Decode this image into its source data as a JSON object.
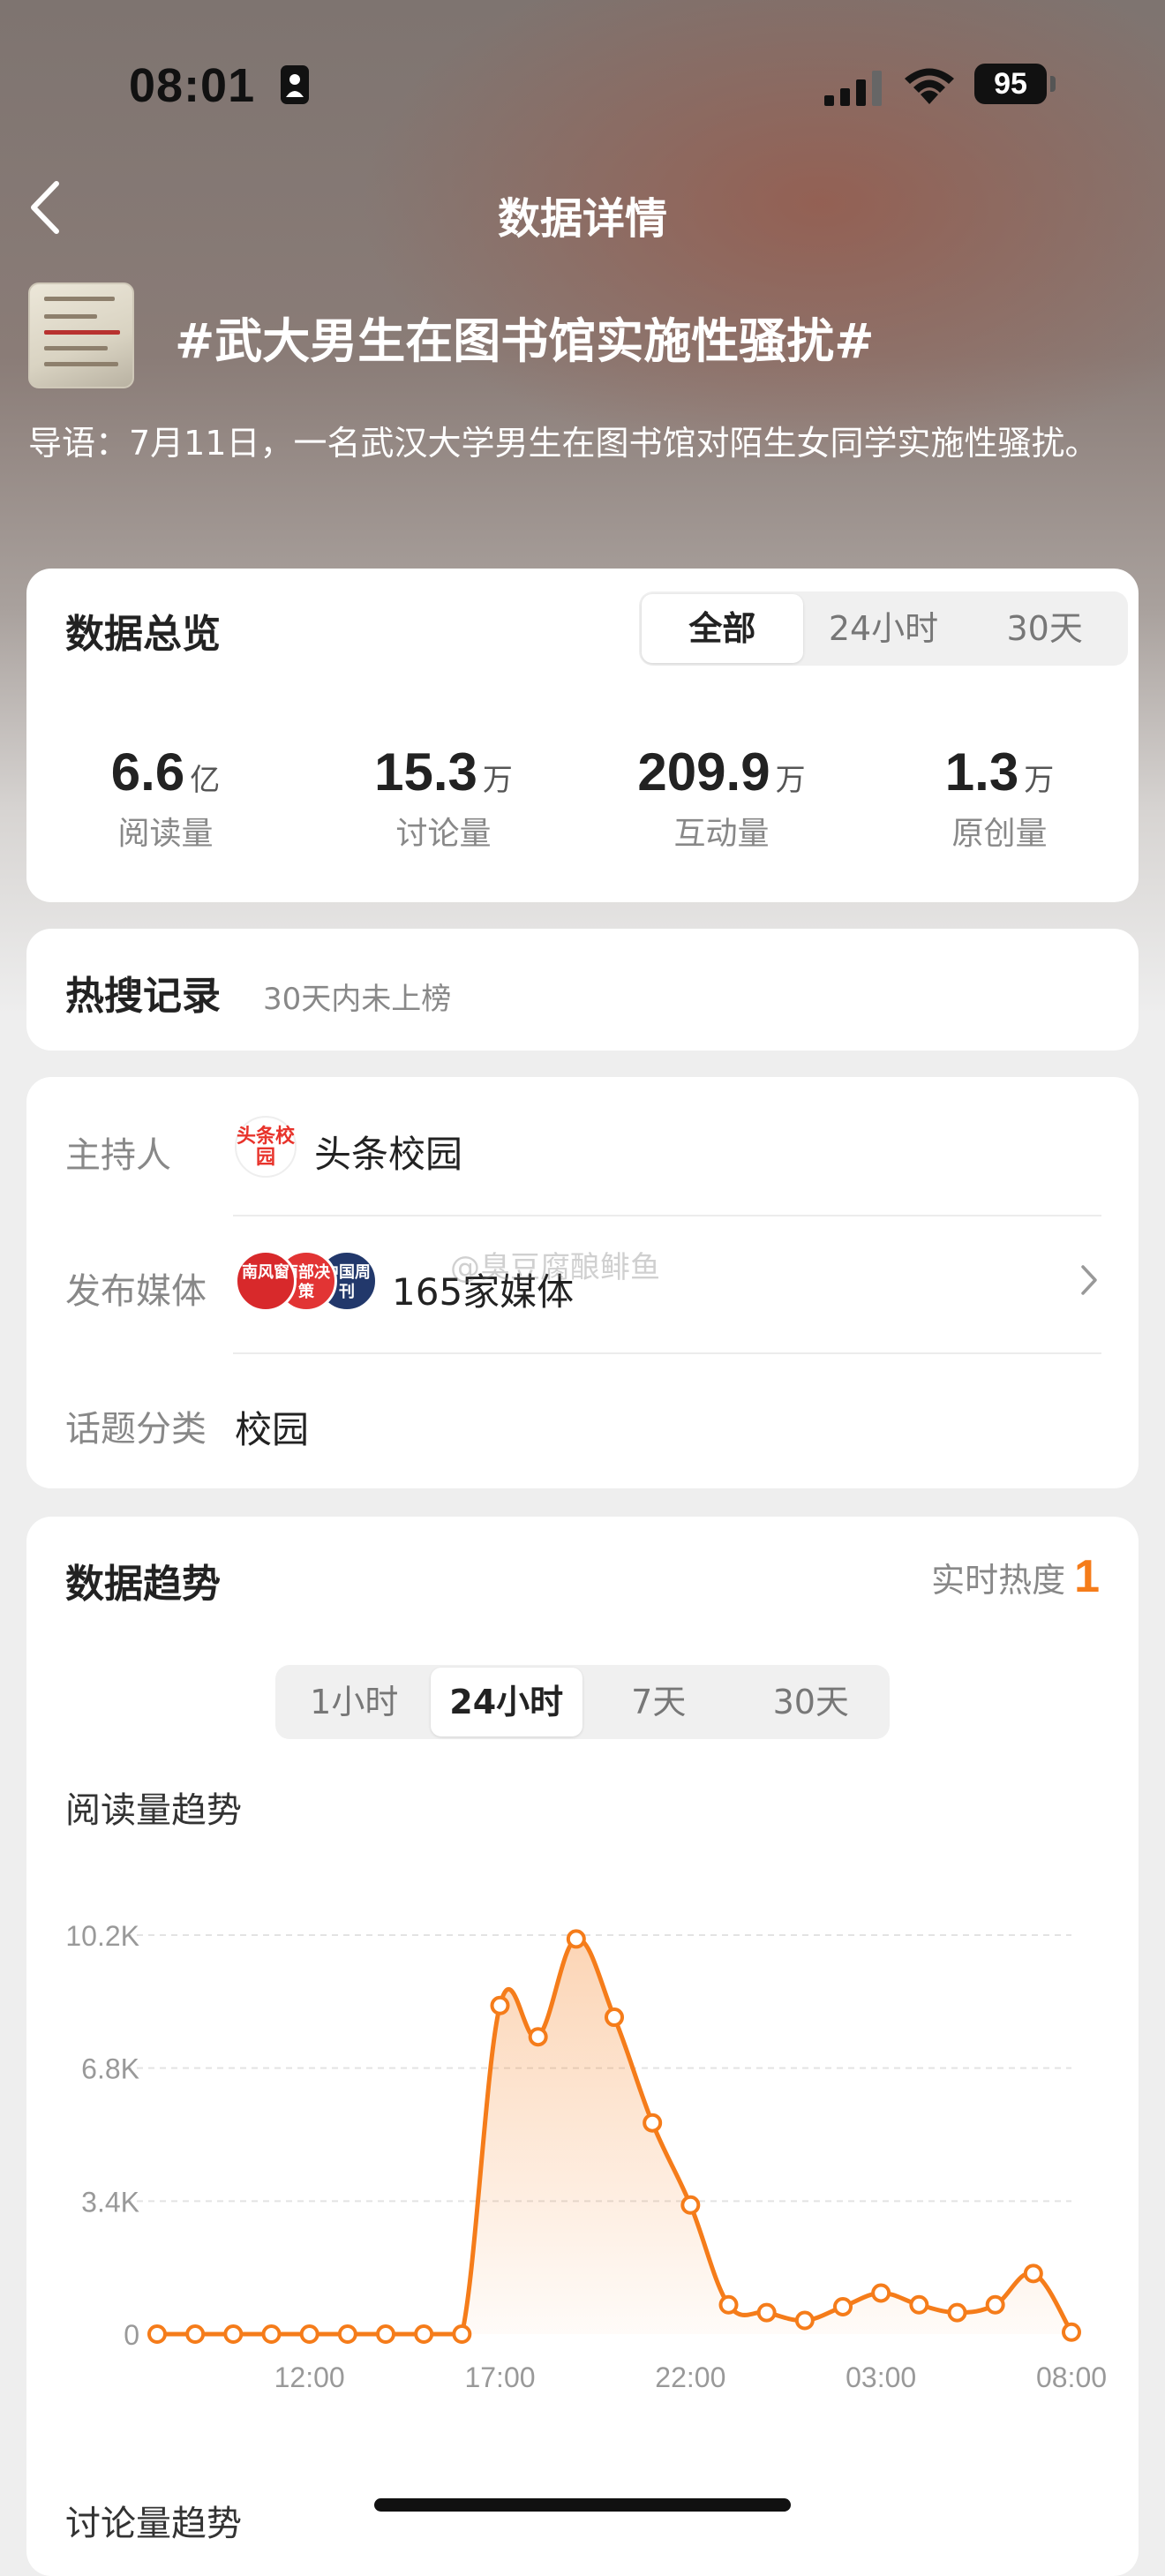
{
  "status_bar": {
    "time": "08:01",
    "battery": "95"
  },
  "nav": {
    "title": "数据详情"
  },
  "topic": {
    "title": "#武大男生在图书馆实施性骚扰#",
    "intro": "导语：7月11日，一名武汉大学男生在图书馆对陌生女同学实施性骚扰。"
  },
  "overview": {
    "title": "数据总览",
    "tabs": [
      "全部",
      "24小时",
      "30天"
    ],
    "stats": [
      {
        "value": "6.6",
        "unit": "亿",
        "label": "阅读量"
      },
      {
        "value": "15.3",
        "unit": "万",
        "label": "讨论量"
      },
      {
        "value": "209.9",
        "unit": "万",
        "label": "互动量"
      },
      {
        "value": "1.3",
        "unit": "万",
        "label": "原创量"
      }
    ]
  },
  "hot_search": {
    "title": "热搜记录",
    "note": "30天内未上榜"
  },
  "info": {
    "host_label": "主持人",
    "host_logo_text": "头条校园",
    "host_name": "头条校园",
    "media_label": "发布媒体",
    "media_logos": [
      "南风窗",
      "南部决策",
      "中国周刊"
    ],
    "media_count": "165家媒体",
    "category_label": "话题分类",
    "category_value": "校园",
    "watermark": "@臭豆腐酿鲱鱼"
  },
  "trend": {
    "title": "数据趋势",
    "realtime_label": "实时热度",
    "realtime_value": "1",
    "tabs": [
      "1小时",
      "24小时",
      "7天",
      "30天"
    ],
    "chart_label": "阅读量趋势",
    "next_label": "讨论量趋势"
  },
  "colors": {
    "accent": "#f57c1a"
  },
  "chart_data": {
    "type": "area",
    "title": "阅读量趋势",
    "xlabel": "",
    "ylabel": "",
    "x": [
      "08:00",
      "09:00",
      "10:00",
      "11:00",
      "12:00",
      "13:00",
      "14:00",
      "15:00",
      "16:00",
      "17:00",
      "18:00",
      "19:00",
      "20:00",
      "21:00",
      "22:00",
      "23:00",
      "00:00",
      "01:00",
      "02:00",
      "03:00",
      "04:00",
      "05:00",
      "06:00",
      "07:00",
      "08:00"
    ],
    "x_tick_labels": [
      "12:00",
      "17:00",
      "22:00",
      "03:00",
      "08:00"
    ],
    "x_tick_indices": [
      4,
      9,
      14,
      19,
      24
    ],
    "y_tick_labels": [
      "0",
      "3.4K",
      "6.8K",
      "10.2K"
    ],
    "y_ticks": [
      0,
      3400,
      6800,
      10200
    ],
    "ylim": [
      0,
      10200
    ],
    "series": [
      {
        "values": [
          0,
          0,
          0,
          0,
          0,
          0,
          0,
          0,
          0,
          8400,
          7600,
          10100,
          8100,
          5400,
          3300,
          750,
          550,
          350,
          700,
          1050,
          750,
          550,
          750,
          1550,
          50
        ]
      }
    ],
    "grid": true
  }
}
